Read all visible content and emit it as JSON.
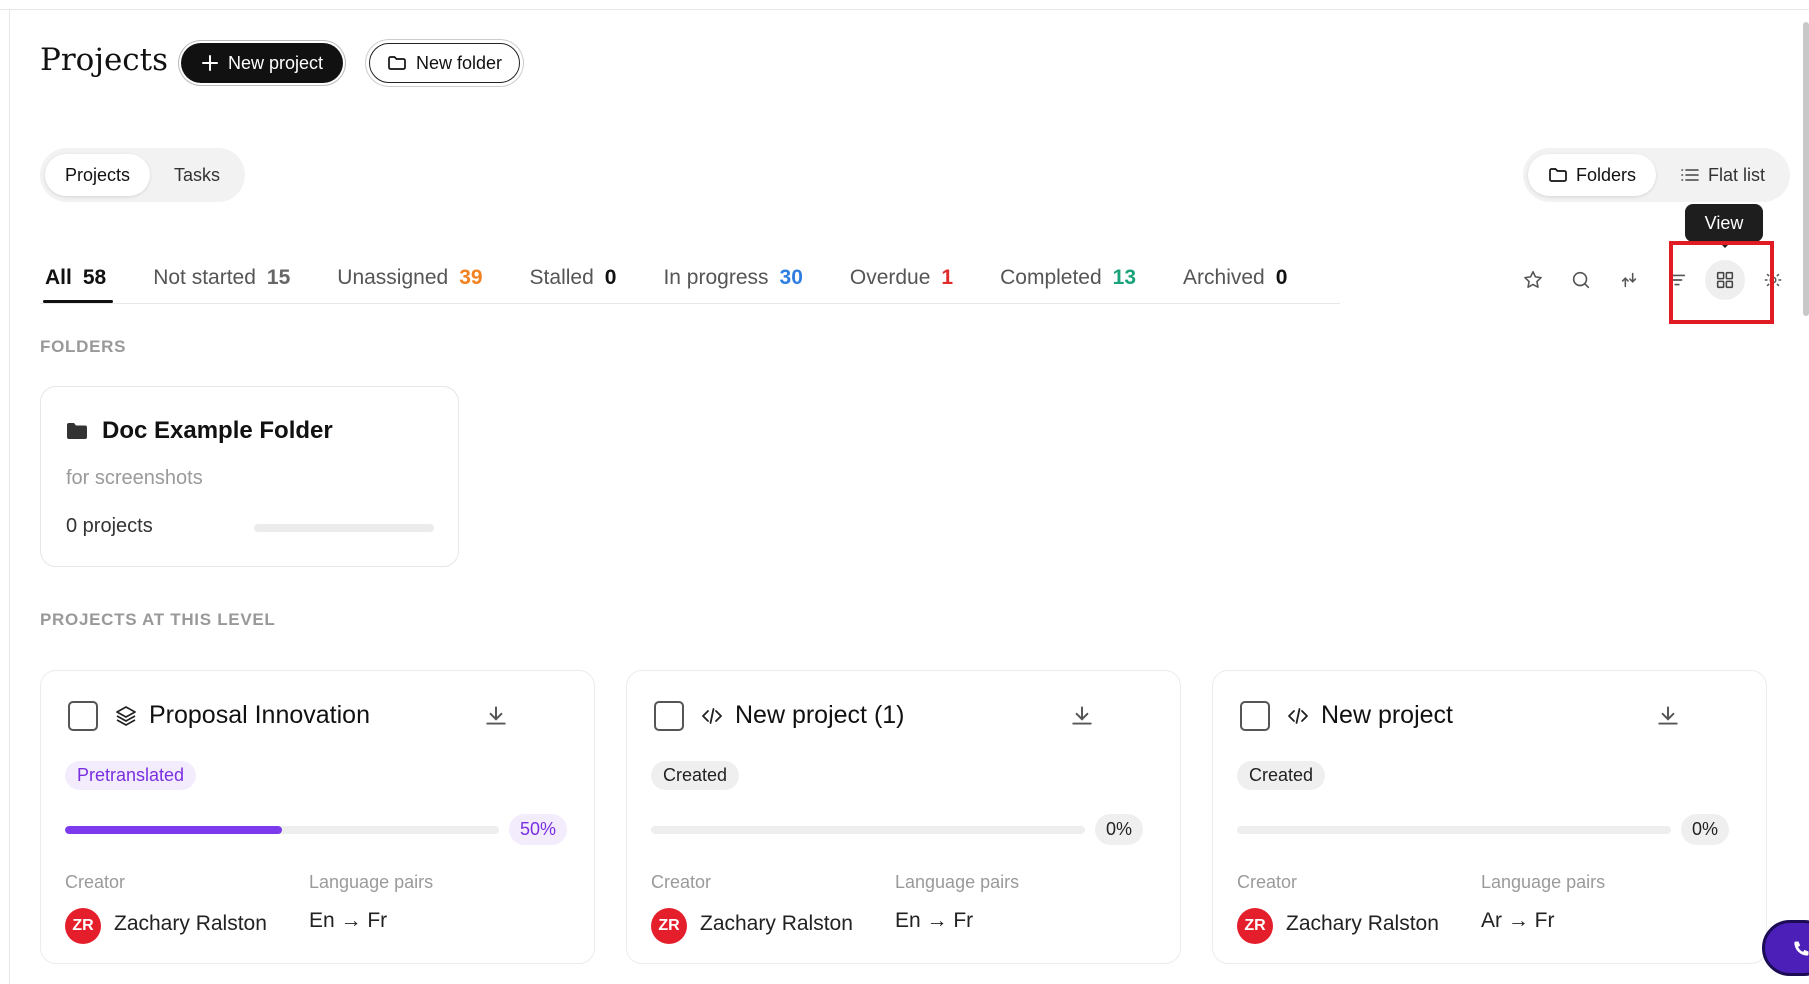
{
  "header": {
    "title": "Projects",
    "new_project_label": "New project",
    "new_folder_label": "New folder"
  },
  "view_toggle_left": {
    "options": [
      "Projects",
      "Tasks"
    ],
    "active": "Projects"
  },
  "view_toggle_right": {
    "options": [
      "Folders",
      "Flat list"
    ],
    "active": "Folders"
  },
  "tooltip": "View",
  "status_filters": [
    {
      "label": "All",
      "count": "58",
      "color": "#111111"
    },
    {
      "label": "Not started",
      "count": "15",
      "color": "#666666"
    },
    {
      "label": "Unassigned",
      "count": "39",
      "color": "#f2821f"
    },
    {
      "label": "Stalled",
      "count": "0",
      "color": "#111111"
    },
    {
      "label": "In progress",
      "count": "30",
      "color": "#2f7fe0"
    },
    {
      "label": "Overdue",
      "count": "1",
      "color": "#e02b2b"
    },
    {
      "label": "Completed",
      "count": "13",
      "color": "#1aa37a"
    },
    {
      "label": "Archived",
      "count": "0",
      "color": "#111111"
    }
  ],
  "toolbar_icons": [
    "star-icon",
    "search-icon",
    "sort-icon",
    "filter-icon",
    "grid-view-icon",
    "settings-icon"
  ],
  "sections": {
    "folders": "FOLDERS",
    "projects": "PROJECTS AT THIS LEVEL"
  },
  "folders": [
    {
      "name": "Doc Example Folder",
      "description": "for screenshots",
      "count": "0 projects",
      "progress": 0
    }
  ],
  "projects": [
    {
      "name": "Proposal Innovation",
      "type_icon": "layers-icon",
      "status": "Pretranslated",
      "progress": 0.5,
      "progress_label": "50%",
      "creator_label": "Creator",
      "creator": "Zachary Ralston",
      "initials": "ZR",
      "languages_label": "Language pairs",
      "languages": "En → Fr"
    },
    {
      "name": "New project (1)",
      "type_icon": "code-icon",
      "status": "Created",
      "progress": 0,
      "progress_label": "0%",
      "creator_label": "Creator",
      "creator": "Zachary Ralston",
      "initials": "ZR",
      "languages_label": "Language pairs",
      "languages": "En → Fr"
    },
    {
      "name": "New project",
      "type_icon": "code-icon",
      "status": "Created",
      "progress": 0,
      "progress_label": "0%",
      "creator_label": "Creator",
      "creator": "Zachary Ralston",
      "initials": "ZR",
      "languages_label": "Language pairs",
      "languages": "Ar → Fr"
    }
  ],
  "colors": {
    "accent": "#7c3aed",
    "avatar": "#e51e2b",
    "highlight_box": "#e01b24"
  }
}
